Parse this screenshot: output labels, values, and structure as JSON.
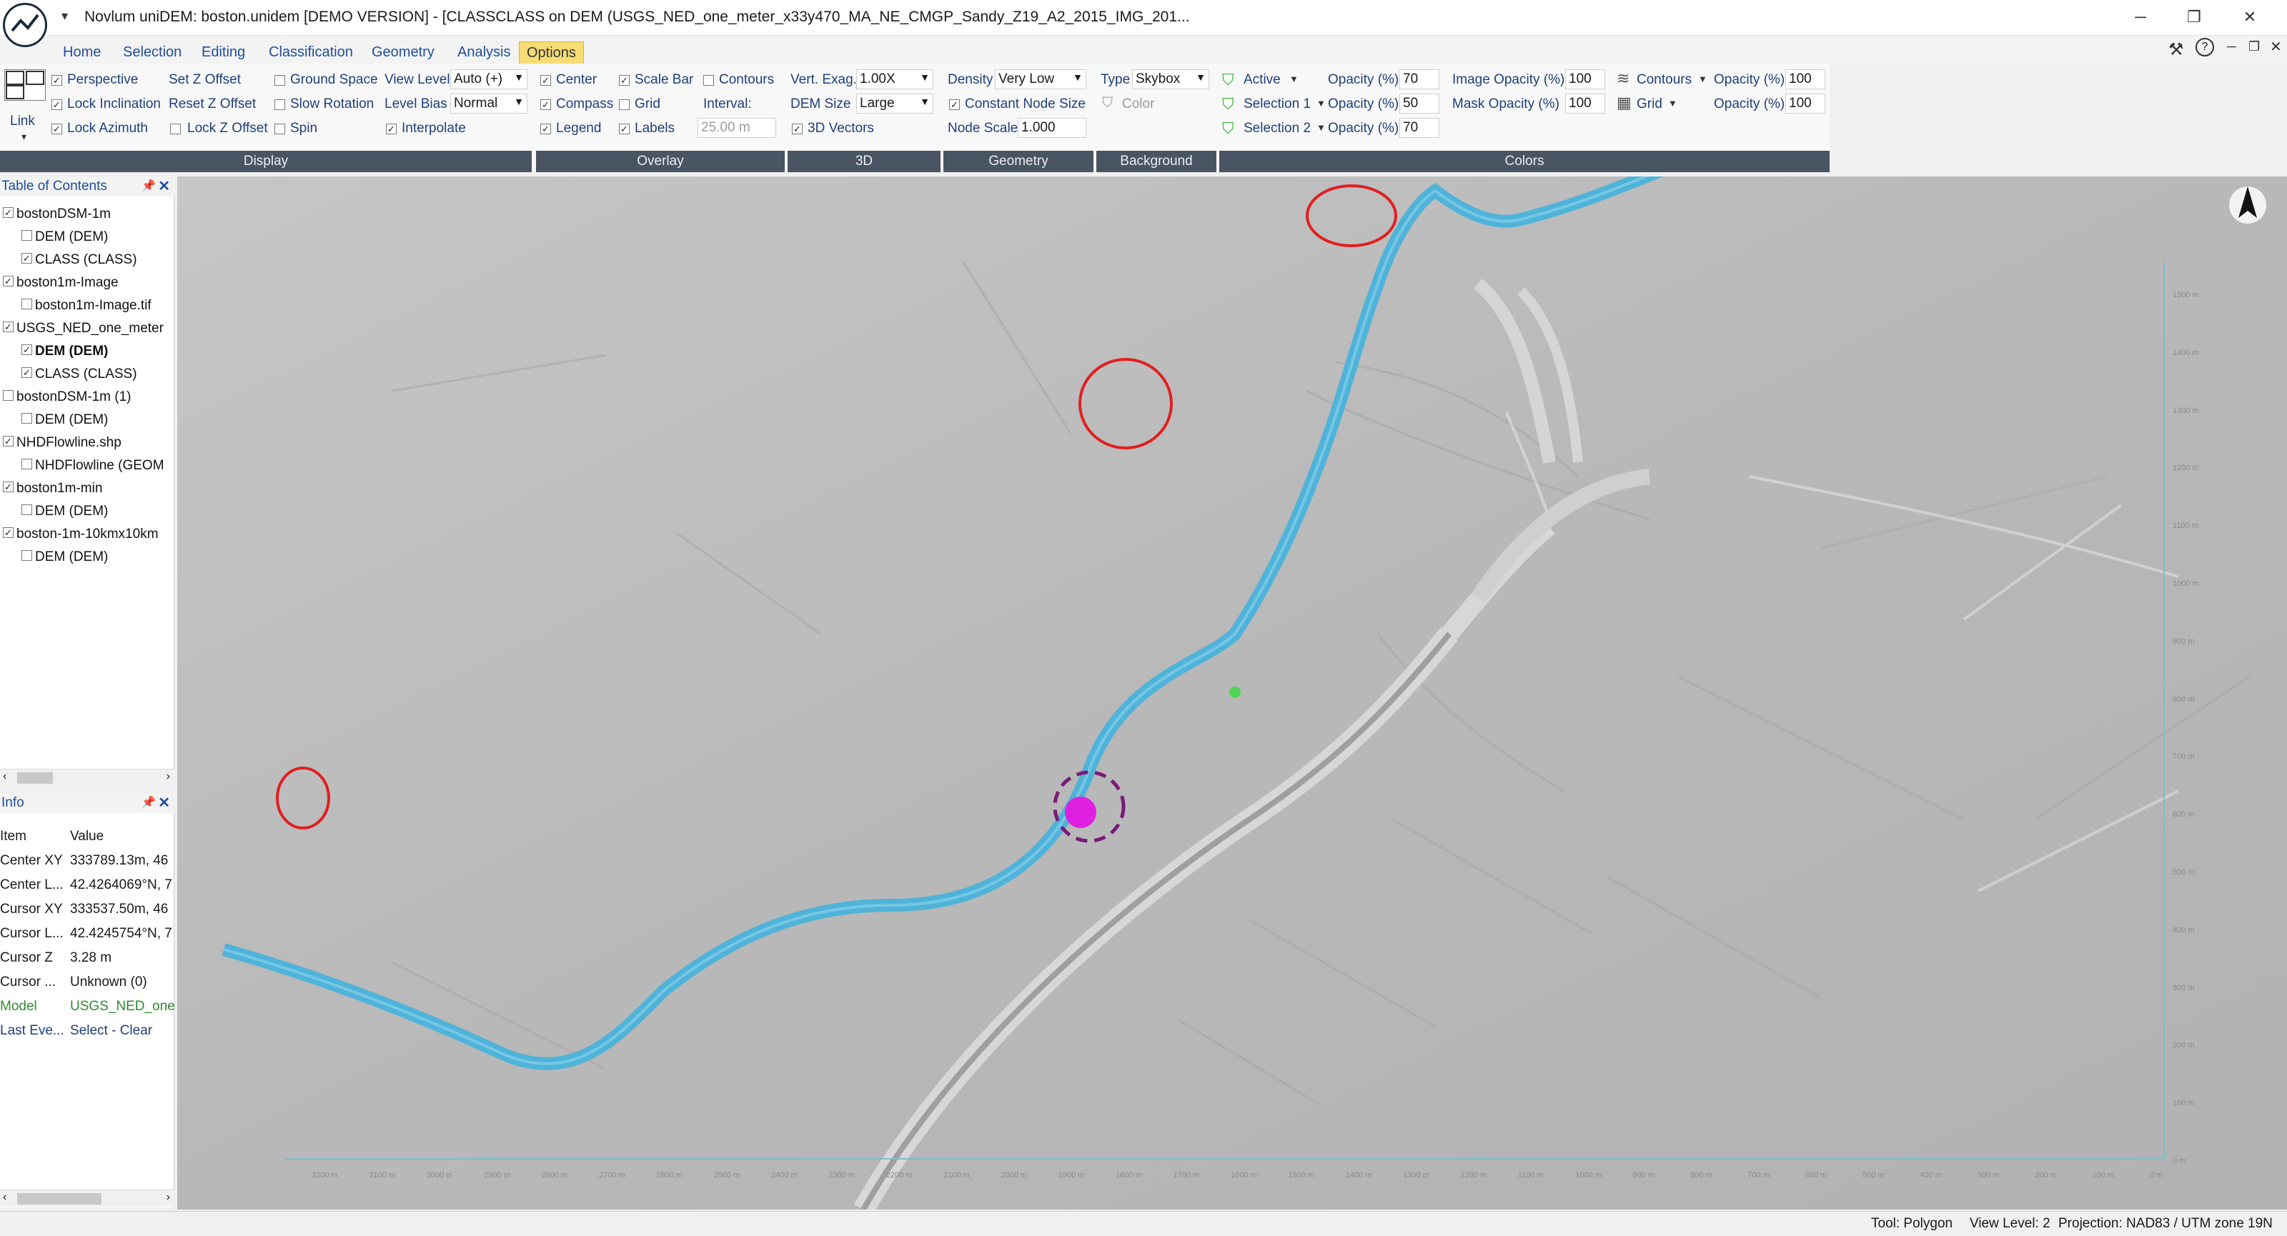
{
  "window": {
    "title": "Novlum uniDEM: boston.unidem [DEMO VERSION] - [CLASSCLASS on DEM (USGS_NED_one_meter_x33y470_MA_NE_CMGP_Sandy_Z19_A2_2015_IMG_201...",
    "minimize": "─",
    "restore": "❐",
    "close": "✕"
  },
  "menu": {
    "tabs": [
      "Home",
      "Selection",
      "Editing",
      "Classification",
      "Geometry",
      "Analysis",
      "Options"
    ],
    "active": "Options"
  },
  "ribbon": {
    "link_label": "Link",
    "display": {
      "perspective": "Perspective",
      "lock_inclination": "Lock Inclination",
      "lock_azimuth": "Lock Azimuth",
      "set_z_offset": "Set Z Offset",
      "reset_z_offset": "Reset Z Offset",
      "lock_z_offset": "Lock Z Offset",
      "ground_space": "Ground Space",
      "slow_rotation": "Slow Rotation",
      "spin": "Spin",
      "view_level_label": "View Level",
      "view_level_value": "Auto (+)",
      "level_bias_label": "Level Bias",
      "level_bias_value": "Normal",
      "interpolate": "Interpolate"
    },
    "overlay": {
      "center": "Center",
      "compass": "Compass",
      "legend": "Legend",
      "scale_bar": "Scale Bar",
      "grid": "Grid",
      "labels": "Labels",
      "contours": "Contours",
      "interval_label": "Interval:",
      "interval_value": "25.00 m"
    },
    "three_d": {
      "vert_exag_label": "Vert. Exag.",
      "vert_exag_value": "1.00X",
      "dem_size_label": "DEM Size",
      "dem_size_value": "Large",
      "vectors": "3D Vectors"
    },
    "geometry": {
      "density_label": "Density",
      "density_value": "Very Low",
      "constant_node_size": "Constant Node Size",
      "node_scale_label": "Node Scale",
      "node_scale_value": "1.000"
    },
    "background": {
      "type_label": "Type",
      "type_value": "Skybox",
      "color_label": "Color"
    },
    "colors": {
      "active": "Active",
      "selection1": "Selection 1",
      "selection2": "Selection 2",
      "opacity_label": "Opacity (%)",
      "opacity_active": "70",
      "opacity_sel1": "50",
      "opacity_sel2": "70",
      "image_opacity_label": "Image Opacity (%)",
      "image_opacity": "100",
      "mask_opacity_label": "Mask Opacity (%)",
      "mask_opacity": "100",
      "contours": "Contours",
      "grid": "Grid",
      "contours_opacity": "100",
      "grid_opacity": "100"
    },
    "groups": [
      "Display",
      "Overlay",
      "3D",
      "Geometry",
      "Background",
      "Colors"
    ]
  },
  "toc": {
    "title": "Table of Contents",
    "pin": "📌",
    "close": "✕",
    "rows": [
      {
        "label": "bostonDSM-1m",
        "level": 0,
        "checked": true,
        "bold": false
      },
      {
        "label": "DEM (DEM)",
        "level": 1,
        "checked": false,
        "bold": false
      },
      {
        "label": "CLASS (CLASS)",
        "level": 1,
        "checked": true,
        "bold": false
      },
      {
        "label": "boston1m-Image",
        "level": 0,
        "checked": true,
        "bold": false
      },
      {
        "label": "boston1m-Image.tif",
        "level": 1,
        "checked": false,
        "bold": false
      },
      {
        "label": "USGS_NED_one_meter",
        "level": 0,
        "checked": true,
        "bold": false
      },
      {
        "label": "DEM (DEM)",
        "level": 1,
        "checked": true,
        "bold": true
      },
      {
        "label": "CLASS (CLASS)",
        "level": 1,
        "checked": true,
        "bold": false
      },
      {
        "label": "bostonDSM-1m (1)",
        "level": 0,
        "checked": false,
        "bold": false
      },
      {
        "label": "DEM (DEM)",
        "level": 1,
        "checked": false,
        "bold": false
      },
      {
        "label": "NHDFlowline.shp",
        "level": 0,
        "checked": true,
        "bold": false
      },
      {
        "label": "NHDFlowline (GEOM",
        "level": 1,
        "checked": false,
        "bold": false
      },
      {
        "label": "boston1m-min",
        "level": 0,
        "checked": true,
        "bold": false
      },
      {
        "label": "DEM (DEM)",
        "level": 1,
        "checked": false,
        "bold": false
      },
      {
        "label": "boston-1m-10kmx10km",
        "level": 0,
        "checked": true,
        "bold": false
      },
      {
        "label": "DEM (DEM)",
        "level": 1,
        "checked": false,
        "bold": false
      }
    ]
  },
  "info": {
    "title": "Info",
    "pin": "📌",
    "close": "✕",
    "col_item": "Item",
    "col_value": "Value",
    "rows": [
      {
        "item": "Center XY",
        "value": "333789.13m, 46"
      },
      {
        "item": "Center L...",
        "value": "42.4264069°N, 7"
      },
      {
        "item": "Cursor XY",
        "value": "333537.50m, 46"
      },
      {
        "item": "Cursor L...",
        "value": "42.4245754°N, 7"
      },
      {
        "item": "Cursor Z",
        "value": "3.28 m"
      },
      {
        "item": "Cursor ...",
        "value": "Unknown (0)"
      },
      {
        "item": "Model",
        "value": "USGS_NED_one",
        "color": "#2e8b2e"
      },
      {
        "item": "Last Eve...",
        "value": "Select - Clear",
        "color": "#1f3f7a"
      }
    ]
  },
  "map": {
    "compass_label": "N",
    "x_axis": [
      "3200 m",
      "3100 m",
      "3000 m",
      "2900 m",
      "2800 m",
      "2700 m",
      "2600 m",
      "2500 m",
      "2400 m",
      "2300 m",
      "2200 m",
      "2100 m",
      "2000 m",
      "1900 m",
      "1800 m",
      "1700 m",
      "1600 m",
      "1500 m",
      "1400 m",
      "1300 m",
      "1200 m",
      "1100 m",
      "1000 m",
      "900 m",
      "800 m",
      "700 m",
      "600 m",
      "500 m",
      "400 m",
      "300 m",
      "200 m",
      "100 m",
      "0 m"
    ],
    "y_axis": [
      "1500 m",
      "1400 m",
      "1300 m",
      "1200 m",
      "1100 m",
      "1000 m",
      "900 m",
      "800 m",
      "700 m",
      "600 m",
      "500 m",
      "400 m",
      "300 m",
      "200 m",
      "100 m",
      "0 m"
    ],
    "river_color": "#4fb3d9",
    "highlight_color": "#e020e0",
    "circle_color": "#e02020"
  },
  "status": {
    "tool": "Tool: Polygon",
    "view_level": "View Level: 2",
    "projection": "Projection: NAD83 / UTM zone 19N"
  }
}
